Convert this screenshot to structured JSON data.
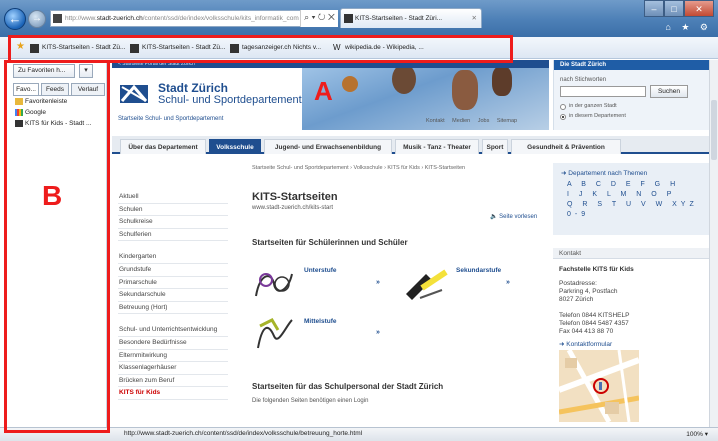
{
  "browser": {
    "address_url": "http://www.stadt-zuerich.ch/content/ssd/de/index/volksschule/kits_informatik_com",
    "address_host": "stadt-zuerich.ch",
    "address_prefix": "http://www.",
    "address_suffix": "/content/ssd/de/index/volksschule/kits_informatik_com",
    "address_controls": "⌕ ▾ ↻ ✕",
    "tab_title": "KITS-Startseiten - Stadt Züri...",
    "tab_close": "✕",
    "window_min": "–",
    "window_max": "□",
    "window_close": "✕",
    "toolbar_icons": "⌂ ★ ⚙"
  },
  "favorites_bar": {
    "items": [
      {
        "label": "KITS-Startseiten - Stadt Zü...",
        "icon": "page-icon"
      },
      {
        "label": "KITS-Startseiten - Stadt Zü...",
        "icon": "page-icon"
      },
      {
        "label": "tagesanzeiger.ch Nichts v...",
        "icon": "page-icon"
      },
      {
        "label": "wikipedia.de - Wikipedia, ...",
        "icon": "wikipedia-icon"
      }
    ]
  },
  "sidebar": {
    "add_button": "Zu Favoriten h...",
    "tabs": [
      "Favo...",
      "Feeds",
      "Verlauf"
    ],
    "items": [
      {
        "label": "Favoritenleiste",
        "icon": "folder-icon"
      },
      {
        "label": "Google",
        "icon": "google-icon"
      },
      {
        "label": "KITS für Kids - Stadt ...",
        "icon": "page-icon"
      }
    ]
  },
  "annotations": {
    "a": "A",
    "b": "B",
    "color": "#ee1c1c"
  },
  "page": {
    "top_strip": "< Startseite Portal der Stadt Zürich",
    "logo_city": "Stadt Zürich",
    "logo_dept": "Schul- und Sportdepartement",
    "home_link": "Startseite Schul- und Sportdepartement",
    "header_links": "Kontakt Medien Jobs Sitemap",
    "search": {
      "title": "Die Stadt Zürich",
      "label": "nach Stichworten",
      "button": "Suchen",
      "radio1": "in der ganzen Stadt",
      "radio2": "in diesem Departement"
    },
    "nav_tabs": [
      "Über das Departement",
      "Volksschule",
      "Jugend- und Erwachsenenbildung",
      "Musik - Tanz - Theater",
      "Sport",
      "Gesundheit & Prävention"
    ],
    "breadcrumb": "Startseite Schul- und Sportdepartement  ›  Volksschule  ›  KITS für Kids  ›  KITS-Startseiten",
    "left_nav": [
      "Aktuell",
      "Schulen",
      "Schulkreise",
      "Schulferien",
      "",
      "Kindergarten",
      "Grundstufe",
      "Primarschule",
      "Sekundarschule",
      "Betreuung (Hort)",
      "",
      "Schul- und Unterrichtsentwicklung",
      "Besondere Bedürfnisse",
      "Elternmitwirkung",
      "Klassenlagerhäuser",
      "Brücken zum Beruf",
      "KITS für Kids"
    ],
    "title": "KITS-Startseiten",
    "url": "www.stadt-zuerich.ch/kits-start",
    "read_aloud": "Seite vorlesen",
    "section1": "Startseiten für Schülerinnen und Schüler",
    "cards": [
      {
        "title": "Unterstufe",
        "arrow": "»"
      },
      {
        "title": "Sekundarstufe",
        "arrow": "»"
      },
      {
        "title": "Mittelstufe",
        "arrow": "»"
      }
    ],
    "section2": "Startseiten für das Schulpersonal der Stadt Zürich",
    "section2_sub": "Die folgenden Seiten benötigen einen Login",
    "dept_title": "Departement nach Themen",
    "alpha_rows": [
      "A B C D E F G H",
      "I J K L M N O P",
      "Q R S T U V W XYZ",
      "0-9"
    ],
    "kontakt": {
      "head": "Kontakt",
      "name": "Fachstelle KITS für Kids",
      "lines": [
        "Postadresse:",
        "Parkring 4, Postfach",
        "8027 Zürich",
        "",
        "Telefon  0844 KITSHELP",
        "Telefon  0844 5487 4357",
        "Fax        044 413 88 70"
      ],
      "form": "Kontaktformular"
    }
  },
  "status": {
    "url": "http://www.stadt-zuerich.ch/content/ssd/de/index/volksschule/betreuung_horte.html",
    "zoom": "100%  ▾"
  }
}
